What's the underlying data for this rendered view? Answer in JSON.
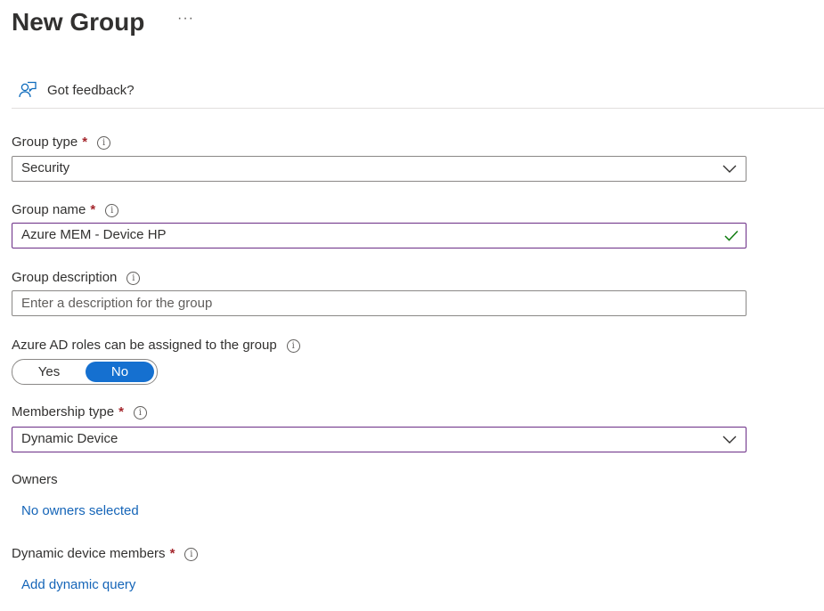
{
  "page": {
    "title": "New Group",
    "more_label": "···",
    "feedback_label": "Got feedback?"
  },
  "form": {
    "group_type": {
      "label": "Group type",
      "required": "*",
      "value": "Security"
    },
    "group_name": {
      "label": "Group name",
      "required": "*",
      "value": "Azure MEM - Device HP"
    },
    "group_description": {
      "label": "Group description",
      "value": "",
      "placeholder": "Enter a description for the group"
    },
    "azure_ad_roles": {
      "label": "Azure AD roles can be assigned to the group",
      "yes_label": "Yes",
      "no_label": "No",
      "selected": "No"
    },
    "membership_type": {
      "label": "Membership type",
      "required": "*",
      "value": "Dynamic Device"
    },
    "owners": {
      "label": "Owners",
      "link": "No owners selected"
    },
    "dynamic_device_members": {
      "label": "Dynamic device members",
      "required": "*",
      "link": "Add dynamic query"
    }
  },
  "icons": {
    "info": "info-icon",
    "chevron": "chevron-down-icon",
    "check": "checkmark-icon",
    "feedback": "feedback-icon"
  },
  "colors": {
    "accent": "#1570d0",
    "link": "#1565b8",
    "required": "#a4262c",
    "focus_border": "#6b2d86",
    "valid_check": "#107c10"
  }
}
